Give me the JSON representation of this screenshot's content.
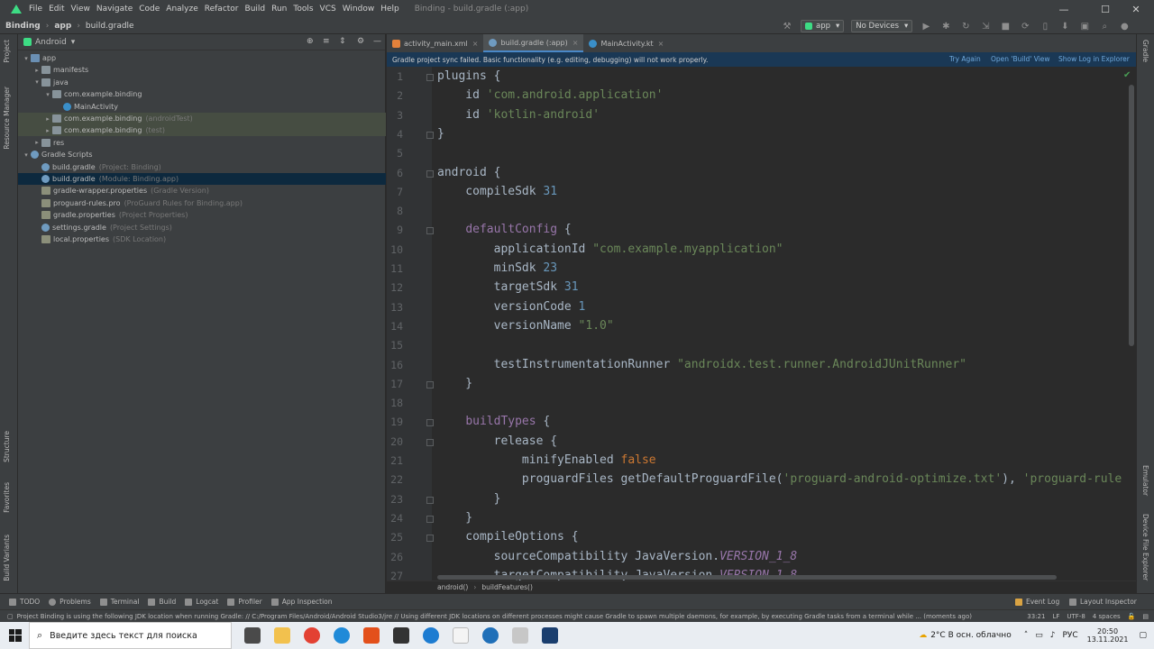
{
  "menubar": {
    "items": [
      "File",
      "Edit",
      "View",
      "Navigate",
      "Code",
      "Analyze",
      "Refactor",
      "Build",
      "Run",
      "Tools",
      "VCS",
      "Window",
      "Help"
    ],
    "window_title": "Binding - build.gradle (:app)",
    "minimize": "—",
    "maximize": "☐",
    "close": "✕"
  },
  "navbar": {
    "crumbs": [
      "Binding",
      "app",
      "build.gradle"
    ],
    "run_config": "app",
    "device": "No Devices"
  },
  "left_stripe": {
    "tabs": [
      "Project",
      "Resource Manager",
      "Structure",
      "Favorites",
      "Build Variants"
    ]
  },
  "right_stripe": {
    "tabs": [
      "Gradle",
      "Emulator",
      "Device File Explorer"
    ]
  },
  "project_panel": {
    "view": "Android",
    "tree": [
      {
        "label": "app",
        "hint": "",
        "depth": 0,
        "arrow": "▾",
        "icon": "folder-blue"
      },
      {
        "label": "manifests",
        "hint": "",
        "depth": 1,
        "arrow": "▸",
        "icon": "folder"
      },
      {
        "label": "java",
        "hint": "",
        "depth": 1,
        "arrow": "▾",
        "icon": "folder"
      },
      {
        "label": "com.example.binding",
        "hint": "",
        "depth": 2,
        "arrow": "▾",
        "icon": "folder"
      },
      {
        "label": "MainActivity",
        "hint": "",
        "depth": 3,
        "arrow": "",
        "icon": "kotlin"
      },
      {
        "label": "com.example.binding",
        "hint": "(androidTest)",
        "depth": 2,
        "arrow": "▸",
        "icon": "folder"
      },
      {
        "label": "com.example.binding",
        "hint": "(test)",
        "depth": 2,
        "arrow": "▸",
        "icon": "folder"
      },
      {
        "label": "res",
        "hint": "",
        "depth": 1,
        "arrow": "▸",
        "icon": "folder"
      },
      {
        "label": "Gradle Scripts",
        "hint": "",
        "depth": 0,
        "arrow": "▾",
        "icon": "gradle"
      },
      {
        "label": "build.gradle",
        "hint": "(Project: Binding)",
        "depth": 1,
        "arrow": "",
        "icon": "gradle"
      },
      {
        "label": "build.gradle",
        "hint": "(Module: Binding.app)",
        "depth": 1,
        "arrow": "",
        "icon": "gradle"
      },
      {
        "label": "gradle-wrapper.properties",
        "hint": "(Gradle Version)",
        "depth": 1,
        "arrow": "",
        "icon": "props"
      },
      {
        "label": "proguard-rules.pro",
        "hint": "(ProGuard Rules for Binding.app)",
        "depth": 1,
        "arrow": "",
        "icon": "props"
      },
      {
        "label": "gradle.properties",
        "hint": "(Project Properties)",
        "depth": 1,
        "arrow": "",
        "icon": "props"
      },
      {
        "label": "settings.gradle",
        "hint": "(Project Settings)",
        "depth": 1,
        "arrow": "",
        "icon": "gradle"
      },
      {
        "label": "local.properties",
        "hint": "(SDK Location)",
        "depth": 1,
        "arrow": "",
        "icon": "props"
      }
    ]
  },
  "editor_tabs": [
    {
      "label": "activity_main.xml",
      "active": false
    },
    {
      "label": "build.gradle (:app)",
      "active": true
    },
    {
      "label": "MainActivity.kt",
      "active": false
    }
  ],
  "notification": {
    "text": "Gradle project sync failed. Basic functionality (e.g. editing, debugging) will not work properly.",
    "links": [
      "Try Again",
      "Open 'Build' View",
      "Show Log in Explorer"
    ]
  },
  "code_lines": [
    {
      "n": "1",
      "html": "plugins {"
    },
    {
      "n": "2",
      "html": "    id <span class=\"s\">'com.android.application'</span>"
    },
    {
      "n": "3",
      "html": "    id <span class=\"s\">'kotlin-android'</span>"
    },
    {
      "n": "4",
      "html": "}"
    },
    {
      "n": "5",
      "html": ""
    },
    {
      "n": "6",
      "html": "android {"
    },
    {
      "n": "7",
      "html": "    compileSdk <span class=\"n\">31</span>"
    },
    {
      "n": "8",
      "html": ""
    },
    {
      "n": "9",
      "html": "    <span class=\"p\" style=\"font-style:normal;color:#9876aa\">defaultConfig</span> {"
    },
    {
      "n": "10",
      "html": "        applicationId <span class=\"s\">\"com.example.myapplication\"</span>"
    },
    {
      "n": "11",
      "html": "        minSdk <span class=\"n\">23</span>"
    },
    {
      "n": "12",
      "html": "        targetSdk <span class=\"n\">31</span>"
    },
    {
      "n": "13",
      "html": "        versionCode <span class=\"n\">1</span>"
    },
    {
      "n": "14",
      "html": "        versionName <span class=\"s\">\"1.0\"</span>"
    },
    {
      "n": "15",
      "html": ""
    },
    {
      "n": "16",
      "html": "        testInstrumentationRunner <span class=\"s\">\"androidx.test.runner.AndroidJUnitRunner\"</span>"
    },
    {
      "n": "17",
      "html": "    }"
    },
    {
      "n": "18",
      "html": ""
    },
    {
      "n": "19",
      "html": "    <span style=\"color:#9876aa\">buildTypes</span> {"
    },
    {
      "n": "20",
      "html": "        release {"
    },
    {
      "n": "21",
      "html": "            minifyEnabled <span class=\"k\">false</span>"
    },
    {
      "n": "22",
      "html": "            proguardFiles getDefaultProguardFile(<span class=\"s\">'proguard-android-optimize.txt'</span>), <span class=\"s\">'proguard-rule</span>"
    },
    {
      "n": "23",
      "html": "        }"
    },
    {
      "n": "24",
      "html": "    }"
    },
    {
      "n": "25",
      "html": "    compileOptions {"
    },
    {
      "n": "26",
      "html": "        sourceCompatibility JavaVersion.<span class=\"p\">VERSION_1_8</span>"
    },
    {
      "n": "27",
      "html": "        targetCompatibility JavaVersion.<span class=\"p\">VERSION_1_8</span>"
    }
  ],
  "code_crumbs": [
    "android()",
    "buildFeatures()"
  ],
  "bottom_tools": {
    "left": [
      "TODO",
      "Problems",
      "Terminal",
      "Build",
      "Logcat",
      "Profiler",
      "App Inspection"
    ],
    "right": [
      "Event Log",
      "Layout Inspector"
    ]
  },
  "status": {
    "message": "Project Binding is using the following JDK location when running Gradle: // C:/Program Files/Android/Android Studio3/jre // Using different JDK locations on different processes might cause Gradle to spawn multiple daemons, for example, by executing Gradle tasks from a terminal while ... (moments ago)",
    "position": "33:21",
    "line_sep": "LF",
    "encoding": "UTF-8",
    "indent": "4 spaces"
  },
  "taskbar": {
    "search_placeholder": "Введите здесь текст для поиска",
    "weather": "2°C  В осн. облачно",
    "lang": "РУС",
    "time": "20:50",
    "date": "13.11.2021"
  }
}
